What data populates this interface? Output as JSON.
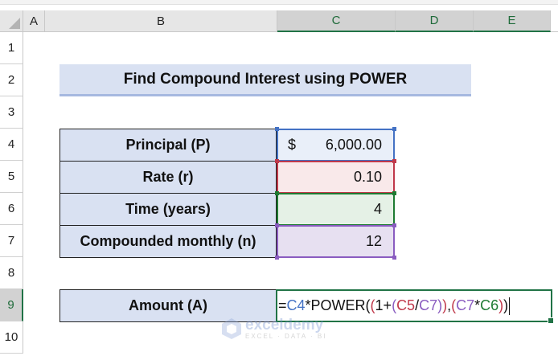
{
  "columns": [
    "A",
    "B",
    "C",
    "D",
    "E"
  ],
  "rows": [
    "1",
    "2",
    "3",
    "4",
    "5",
    "6",
    "7",
    "8",
    "9",
    "10"
  ],
  "title": "Find Compound Interest using POWER",
  "table": [
    {
      "label": "Principal (P)",
      "currency": "$",
      "value": "6,000.00",
      "color": "#4472c4",
      "fill": "#e9eff9"
    },
    {
      "label": "Rate (r)",
      "value": "0.10",
      "color": "#c0394b",
      "fill": "#f9e9ea"
    },
    {
      "label": "Time (years)",
      "value": "4",
      "color": "#1e7b32",
      "fill": "#e5f1e6"
    },
    {
      "label": "Compounded monthly (n)",
      "value": "12",
      "color": "#8a5cc0",
      "fill": "#e7e0f1"
    }
  ],
  "amount_label": "Amount (A)",
  "formula": [
    {
      "t": "=",
      "c": "#111"
    },
    {
      "t": "C4",
      "c": "#4472c4"
    },
    {
      "t": "*POWER(",
      "c": "#111"
    },
    {
      "t": "(",
      "c": "#c0394b"
    },
    {
      "t": "1+",
      "c": "#111"
    },
    {
      "t": "(",
      "c": "#8a5cc0"
    },
    {
      "t": "C5",
      "c": "#c0394b"
    },
    {
      "t": "/",
      "c": "#111"
    },
    {
      "t": "C7",
      "c": "#8a5cc0"
    },
    {
      "t": ")",
      "c": "#8a5cc0"
    },
    {
      "t": ")",
      "c": "#c0394b"
    },
    {
      "t": ",",
      "c": "#111"
    },
    {
      "t": "(",
      "c": "#c0394b"
    },
    {
      "t": "C7",
      "c": "#8a5cc0"
    },
    {
      "t": "*",
      "c": "#111"
    },
    {
      "t": "C6",
      "c": "#1e7b32"
    },
    {
      "t": ")",
      "c": "#c0394b"
    },
    {
      "t": ")",
      "c": "#111"
    }
  ],
  "watermark": {
    "name": "exceldemy",
    "tagline": "EXCEL · DATA · BI"
  }
}
